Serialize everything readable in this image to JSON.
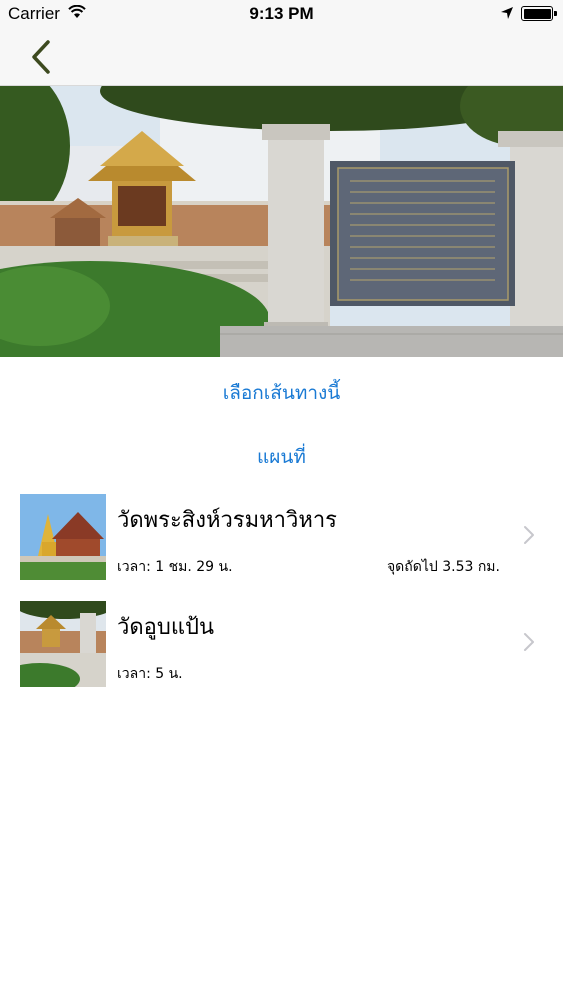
{
  "status_bar": {
    "carrier": "Carrier",
    "time": "9:13 PM"
  },
  "nav": {
    "back_icon": "chevron-left-icon"
  },
  "hero": {
    "description": "temple-shrine-and-stone-inscription-photo"
  },
  "actions": {
    "choose_route": "เลือกเส้นทางนี้",
    "map": "แผนที่"
  },
  "route": [
    {
      "name": "วัดพระสิงห์วรมหาวิหาร",
      "time": "เวลา: 1 ชม. 29 น.",
      "next": "จุดถัดไป 3.53 กม."
    },
    {
      "name": "วัดอูบแป้น",
      "time": "เวลา: 5 น.",
      "next": ""
    }
  ],
  "colors": {
    "accent": "#1a7ad4",
    "nav_bg": "#f7f7f7",
    "back_arrow": "#3d4a1f",
    "chevron": "#c7c7cc"
  }
}
